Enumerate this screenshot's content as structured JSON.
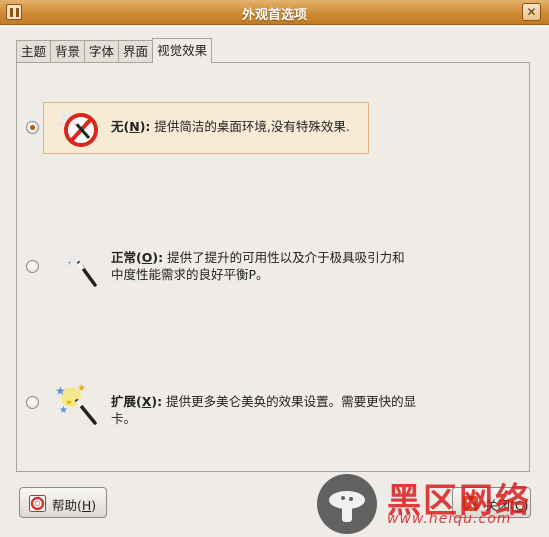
{
  "window": {
    "title": "外观首选项",
    "close_glyph": "✕"
  },
  "tabs": [
    {
      "label": "主题",
      "active": false
    },
    {
      "label": "背景",
      "active": false
    },
    {
      "label": "字体",
      "active": false
    },
    {
      "label": "界面",
      "active": false
    },
    {
      "label": "视觉效果",
      "active": true
    }
  ],
  "options": [
    {
      "label_pre": "无(",
      "mnemonic": "N",
      "label_post": "):",
      "description": "提供简洁的桌面环境,没有特殊效果.",
      "selected": true,
      "icon": "no-effects-icon"
    },
    {
      "label_pre": "正常(",
      "mnemonic": "O",
      "label_post": "):",
      "description_line1": "提供了提升的可用性以及介于极具吸引力和",
      "description_line2": "中度性能需求的良好平衡P。",
      "selected": false,
      "icon": "magic-wand-icon"
    },
    {
      "label_pre": "扩展(",
      "mnemonic": "X",
      "label_post": "):",
      "description": "提供更多美仑美奂的效果设置。需要更快的显卡。",
      "selected": false,
      "icon": "magic-wand-sparkles-icon"
    }
  ],
  "buttons": {
    "help": {
      "label_pre": "帮助(",
      "mnemonic": "H",
      "label_post": ")",
      "icon": "help-lifebuoy-icon"
    },
    "close": {
      "label_pre": "关闭(",
      "mnemonic": "C",
      "label_post": ")",
      "icon": "close-x-icon"
    }
  },
  "watermark": {
    "big_text": "黑区网络",
    "url_text": "www.heiqu.com"
  },
  "colors": {
    "titlebar": "#cf8a34",
    "selected_bg": "#f8ebd5",
    "radio_dot": "#b35a12",
    "watermark_red": "#d71e1e"
  }
}
